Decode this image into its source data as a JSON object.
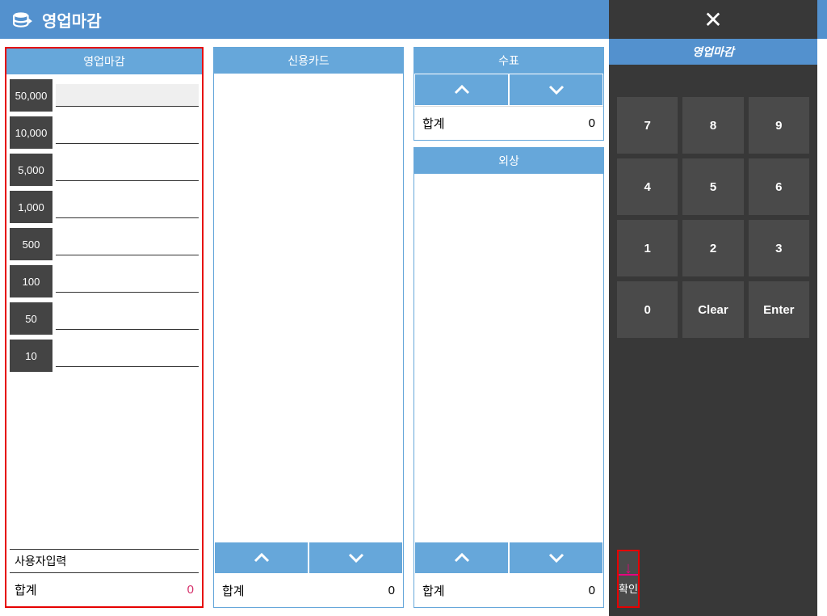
{
  "header": {
    "title": "영업마감"
  },
  "cashPanel": {
    "title": "영업마감",
    "denominations": [
      "50,000",
      "10,000",
      "5,000",
      "1,000",
      "500",
      "100",
      "50",
      "10"
    ],
    "userInputLabel": "사용자입력",
    "totalLabel": "합계",
    "totalValue": "0"
  },
  "cardPanel": {
    "title": "신용카드",
    "totalLabel": "합계",
    "totalValue": "0"
  },
  "checkPanel": {
    "title": "수표",
    "subTotalLabel": "합계",
    "subTotalValue": "0"
  },
  "creditPanel": {
    "title": "외상",
    "totalLabel": "합계",
    "totalValue": "0"
  },
  "sidePanel": {
    "title": "영업마감",
    "keys": [
      "7",
      "8",
      "9",
      "4",
      "5",
      "6",
      "1",
      "2",
      "3",
      "0",
      "Clear",
      "Enter"
    ],
    "confirmLabel": "확인"
  }
}
